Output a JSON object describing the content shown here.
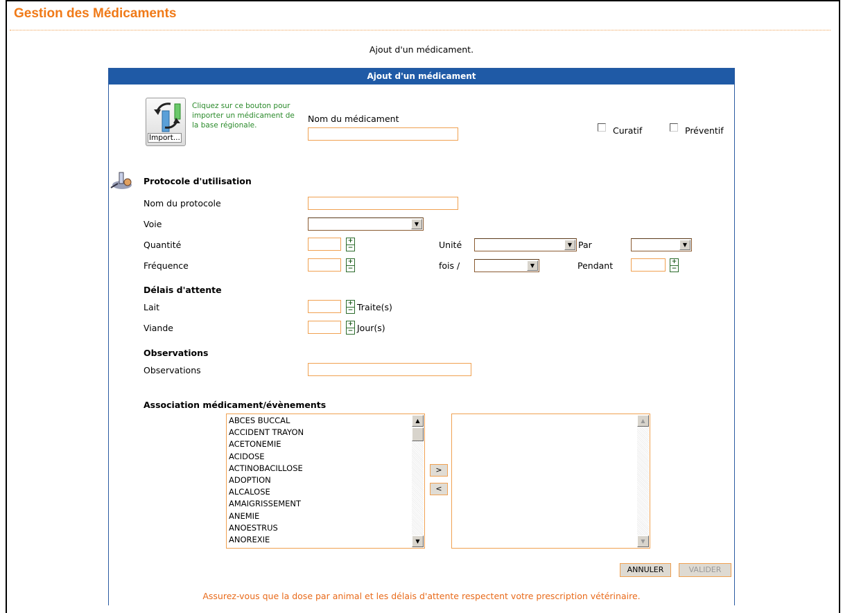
{
  "app_title": "Gestion des Médicaments",
  "subtitle": "Ajout d'un médicament.",
  "panel_title": "Ajout d'un médicament",
  "import": {
    "button_label": "Import...",
    "help_text": "Cliquez sur ce bouton pour importer un médicament de la base régionale."
  },
  "medicament": {
    "name_label": "Nom du médicament",
    "name_value": "",
    "curatif_label": "Curatif",
    "curatif_checked": false,
    "preventif_label": "Préventif",
    "preventif_checked": false
  },
  "protocole": {
    "section_title": "Protocole d'utilisation",
    "nom_label": "Nom du protocole",
    "nom_value": "",
    "voie_label": "Voie",
    "voie_value": "",
    "quantite_label": "Quantité",
    "quantite_value": "",
    "unite_label": "Unité",
    "unite_value": "",
    "par_label": "Par",
    "par_value": "",
    "frequence_label": "Fréquence",
    "frequence_value": "",
    "fois_label": "fois /",
    "fois_value": "",
    "pendant_label": "Pendant",
    "pendant_value": ""
  },
  "delais": {
    "section_title": "Délais d'attente",
    "lait_label": "Lait",
    "lait_value": "",
    "lait_unit": "Traite(s)",
    "viande_label": "Viande",
    "viande_value": "",
    "viande_unit": "Jour(s)"
  },
  "observations": {
    "section_title": "Observations",
    "label": "Observations",
    "value": ""
  },
  "association": {
    "section_title": "Association médicament/évènements",
    "available_events": [
      "ABCES BUCCAL",
      "ACCIDENT TRAYON",
      "ACETONEMIE",
      "ACIDOSE",
      "ACTINOBACILLOSE",
      "ADOPTION",
      "ALCALOSE",
      "AMAIGRISSEMENT",
      "ANEMIE",
      "ANOESTRUS",
      "ANOREXIE"
    ],
    "selected_events": [],
    "add_label": ">",
    "remove_label": "<"
  },
  "actions": {
    "cancel_label": "ANNULER",
    "validate_label": "VALIDER"
  },
  "footer_note": "Assurez-vous que la dose par animal et les délais d'attente respectent votre prescription vétérinaire.",
  "colors": {
    "title_orange": "#f07a18",
    "header_blue": "#1f5aa6",
    "field_border": "#f0a050",
    "help_green": "#2a8a2a",
    "note_orange": "#e86a1a"
  }
}
